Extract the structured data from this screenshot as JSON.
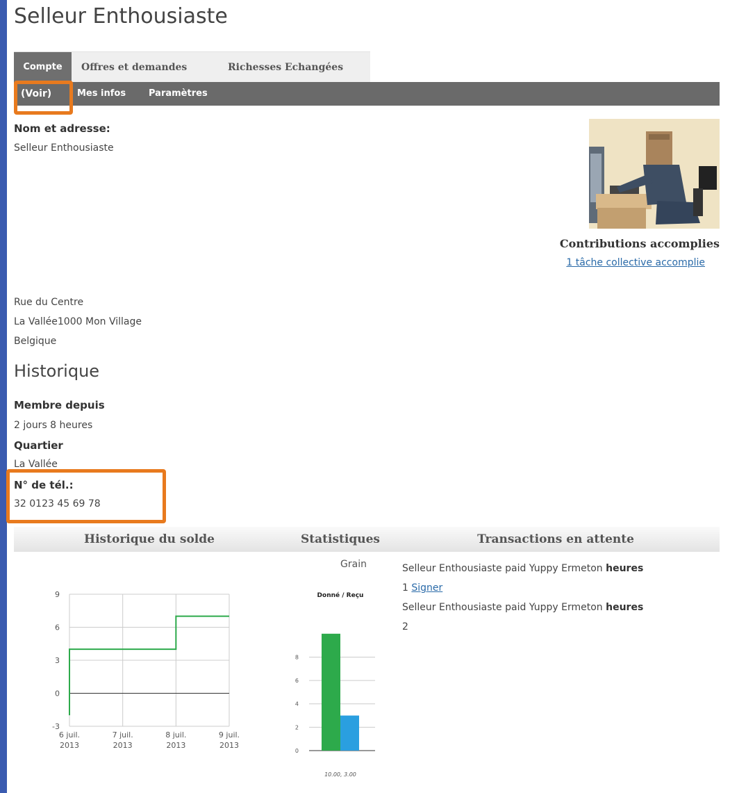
{
  "page": {
    "title": "Selleur Enthousiaste"
  },
  "tabs": [
    {
      "label": "Compte",
      "active": true
    },
    {
      "label": "Offres et demandes",
      "active": false
    },
    {
      "label": "Richesses Echangées",
      "active": false
    }
  ],
  "subnav": [
    {
      "label": "(Voir)",
      "active": true
    },
    {
      "label": "Mes infos",
      "active": false
    },
    {
      "label": "Paramètres",
      "active": false
    }
  ],
  "profile": {
    "name_label": "Nom et adresse:",
    "name": "Selleur  Enthousiaste",
    "address_line1": "Rue du Centre",
    "address_line2": "La Vallée1000  Mon Village",
    "address_line3": "Belgique",
    "contributions_title": "Contributions accomplies",
    "contributions_link": "1 tâche collective accomplie"
  },
  "history": {
    "title": "Historique",
    "member_since_label": "Membre depuis",
    "member_since_value": "2 jours 8 heures",
    "quartier_label": "Quartier",
    "quartier_value": "La Vallée",
    "phone_label": "N° de tél.:",
    "phone_value": "32 0123 45 69 78"
  },
  "columns": {
    "balance": "Historique du solde",
    "stats": "Statistiques",
    "pending": "Transactions en attente"
  },
  "stats": {
    "currency": "Grain"
  },
  "pending_transactions": [
    {
      "text": "Selleur Enthousiaste paid Yuppy Ermeton",
      "unit": "heures",
      "amount": "1",
      "action": "Signer"
    },
    {
      "text": "Selleur Enthousiaste paid Yuppy Ermeton",
      "unit": "heures",
      "amount": "2",
      "action": ""
    }
  ],
  "colors": {
    "highlight": "#e87a1e",
    "series_green": "#2daa4b",
    "series_blue": "#2a9fe0",
    "link": "#2a6aa8",
    "nav_dark": "#6a6a6a"
  },
  "chart_data": [
    {
      "type": "line",
      "x": [
        "6 juil. 2013",
        "6 juil. 2013",
        "8 juil. 2013",
        "8 juil. 2013",
        "9 juil. 2013"
      ],
      "x_ticks": [
        "6 juil.\n2013",
        "7 juil.\n2013",
        "8 juil.\n2013",
        "9 juil.\n2013"
      ],
      "x_tick_values": [
        "6 juil. 2013",
        "7 juil. 2013",
        "8 juil. 2013",
        "9 juil. 2013"
      ],
      "series": [
        {
          "points": [
            [
              "6 juil. 2013",
              -2
            ],
            [
              "6 juil. 2013",
              4
            ],
            [
              "8 juil. 2013",
              4
            ],
            [
              "8 juil. 2013",
              7
            ],
            [
              "9 juil. 2013",
              7
            ]
          ]
        }
      ],
      "step": true,
      "y_ticks": [
        -3,
        0,
        3,
        6,
        9
      ],
      "ylim": [
        -3,
        9
      ],
      "grid": true,
      "zero_line": true
    },
    {
      "type": "bar",
      "title": "Donné / Reçu",
      "categories": [
        "Donné",
        "Reçu"
      ],
      "values": [
        10.0,
        3.0
      ],
      "y_ticks": [
        0,
        2,
        4,
        6,
        8
      ],
      "ylim": [
        0,
        11
      ],
      "caption": "10.00, 3.00"
    }
  ]
}
